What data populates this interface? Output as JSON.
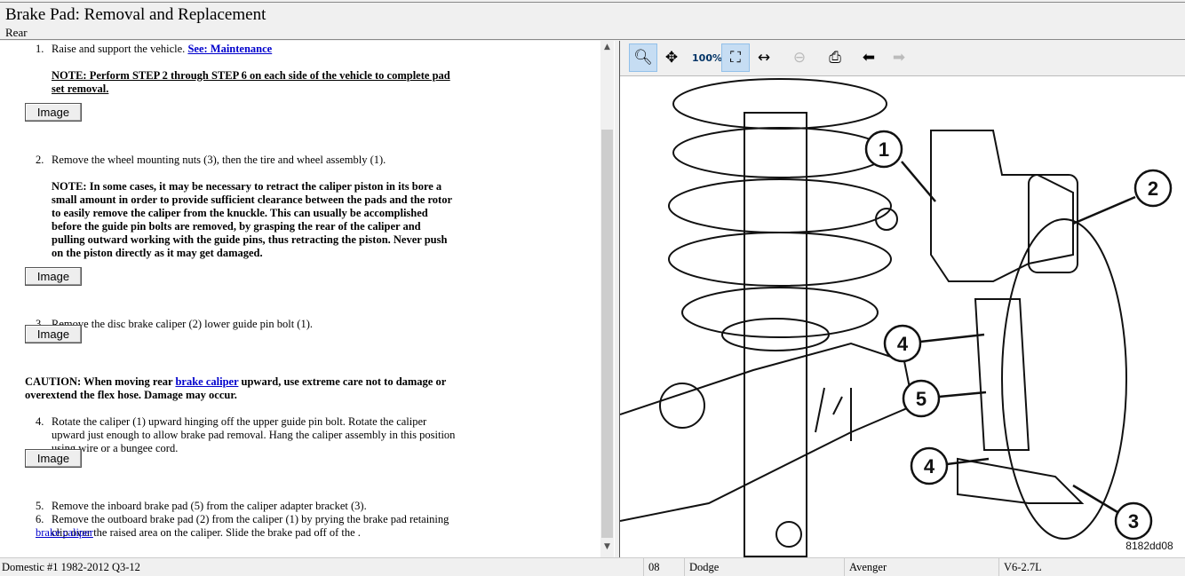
{
  "header": {
    "title": "Brake Pad:  Removal and Replacement",
    "subtitle": "Rear"
  },
  "content": {
    "step1": {
      "num": "1.",
      "text": "Raise and support the vehicle. ",
      "link": "See: Maintenance"
    },
    "note1": "NOTE: Perform STEP 2 through STEP 6 on each side of the vehicle to complete pad set removal.",
    "image_label": "Image",
    "step2": {
      "num": "2.",
      "text": "Remove the wheel mounting nuts (3), then the tire and wheel assembly (1)."
    },
    "note2": "NOTE: In some cases, it may be necessary to retract the caliper piston in its bore a small amount in order to provide sufficient clearance between the pads and the rotor to easily remove the caliper from the knuckle. This can usually be accomplished before the guide pin bolts are removed, by grasping the rear of the caliper and pulling outward working with the guide pins, thus retracting the piston. Never push on the piston directly as it may get damaged.",
    "step3": {
      "num": "3.",
      "text": "Remove the disc brake caliper (2) lower guide pin bolt (1)."
    },
    "caution": {
      "prefix": "CAUTION: When moving rear ",
      "link": "brake caliper",
      "suffix": " upward, use extreme care not to damage or overextend the flex hose. Damage may occur."
    },
    "step4": {
      "num": "4.",
      "text": "Rotate the caliper (1) upward hinging off the upper guide pin bolt. Rotate the caliper upward just enough to allow brake pad removal. Hang the caliper assembly in this position using wire or a bungee cord."
    },
    "step5": {
      "num": "5.",
      "text": "Remove the inboard brake pad (5) from the caliper adapter bracket (3)."
    },
    "step6": {
      "num": "6.",
      "text": "Remove the outboard brake pad (2) from the caliper (1) by prying the brake pad retaining clip over the raised area on the caliper. Slide the brake pad off of the ",
      "link": "brake caliper",
      "end": "."
    }
  },
  "toolbar": [
    "zoom-in",
    "pan",
    "zoom-100",
    "zoom-fit",
    "zoom-width",
    "zoom-out",
    "print",
    "previous-image",
    "next-image"
  ],
  "diagram": {
    "callouts": [
      "1",
      "2",
      "4",
      "5",
      "4",
      "3"
    ],
    "code": "8182dd08"
  },
  "status": {
    "database": "Domestic #1 1982-2012 Q3-12",
    "year": "08",
    "make": "Dodge",
    "model": "Avenger",
    "engine": "V6-2.7L"
  }
}
